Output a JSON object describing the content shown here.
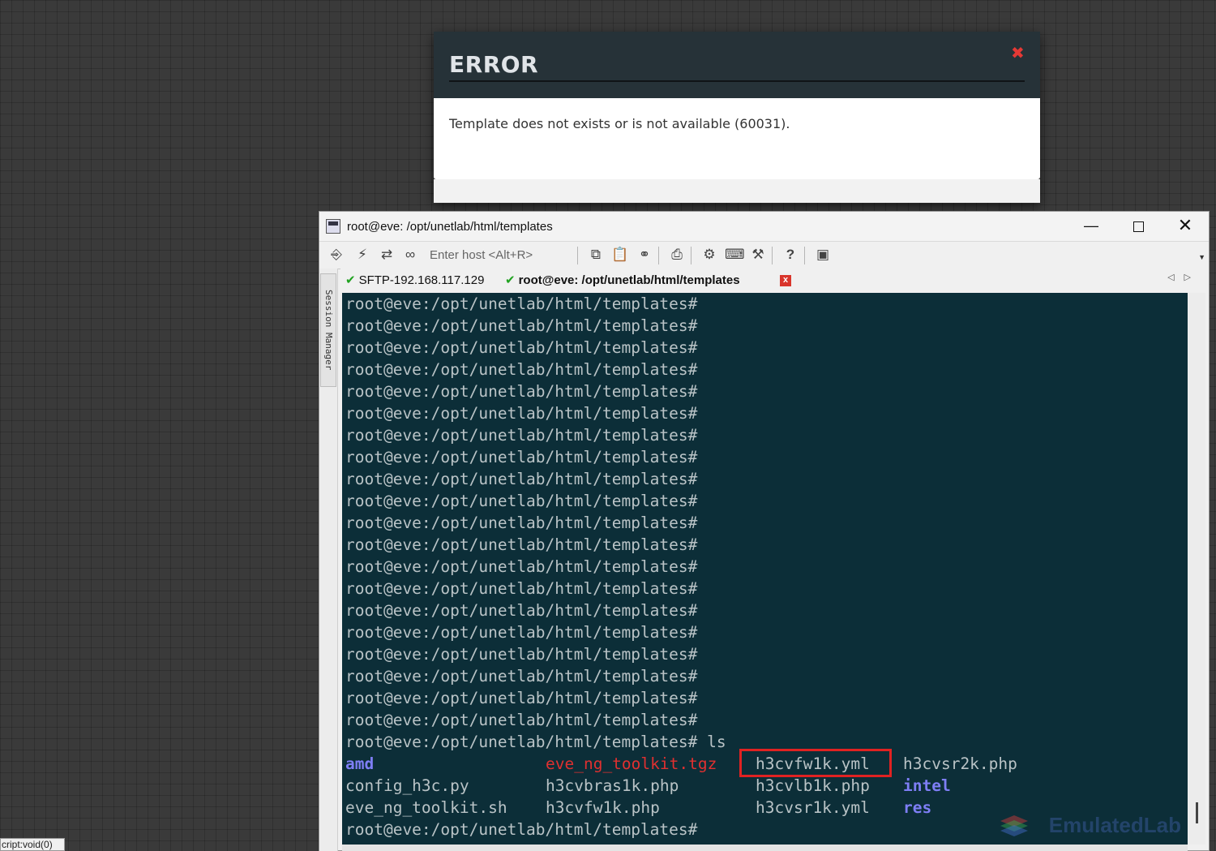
{
  "modal": {
    "title": "ERROR",
    "message": "Template does not exists or is not available (60031).",
    "close_glyph": "✖"
  },
  "window": {
    "title": "root@eve: /opt/unetlab/html/templates",
    "minimize": "—",
    "close": "✕"
  },
  "toolbar": {
    "host_placeholder": "Enter host <Alt+R>",
    "icons": [
      "new-session-icon",
      "lightning-icon",
      "reconnect-icon",
      "link-icon",
      "copy-icon",
      "paste-icon",
      "find-icon",
      "print-icon",
      "settings-icon",
      "keymap-icon",
      "sftp-icon",
      "help-icon",
      "screenshot-icon"
    ]
  },
  "sidebar": {
    "label": "Session Manager"
  },
  "tabs": [
    {
      "label": "SFTP-192.168.117.129",
      "active": false
    },
    {
      "label": "root@eve: /opt/unetlab/html/templates",
      "active": true
    }
  ],
  "terminal": {
    "prompt": "root@eve:/opt/unetlab/html/templates#",
    "repeated_prompts": 20,
    "ls_command": "root@eve:/opt/unetlab/html/templates# ls",
    "ls_output": [
      [
        "amd",
        "eve_ng_toolkit.tgz",
        "h3cvfw1k.yml",
        "h3cvsr2k.php"
      ],
      [
        "config_h3c.py",
        "h3cvbras1k.php",
        "h3cvlb1k.php",
        "intel"
      ],
      [
        "eve_ng_toolkit.sh",
        "h3cvfw1k.php",
        "h3cvsr1k.yml",
        "res"
      ]
    ],
    "highlighted_file": "h3cvfw1k.yml",
    "colors": {
      "background": "#0c2e38",
      "text": "#b9c3c6",
      "dir": "#7e7ef5",
      "archive": "#e03030",
      "highlight": "#e02222"
    }
  },
  "watermark": "EmulatedLab",
  "statusbar": "cript:void(0)"
}
